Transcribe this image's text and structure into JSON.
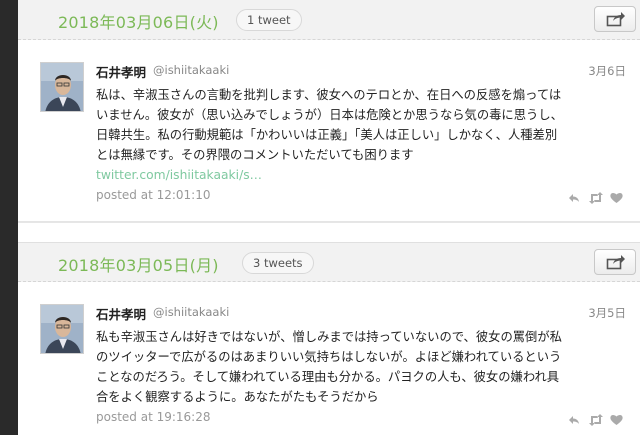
{
  "days": [
    {
      "date": "2018年03月06日(火)",
      "count": "1 tweet",
      "tweets": [
        {
          "name": "石井孝明",
          "handle": "@ishiitakaaki",
          "date": "3月6日",
          "lines": [
            "私は、辛淑玉さんの言動を批判します、彼女へのテロとか、在日への反感を煽っては",
            "いません。彼女が（思い込みでしょうが）日本は危険とか思うなら気の毒に思うし、",
            "日韓共生。私の行動規範は「かわいいは正義」「美人は正しい」しかなく、人種差別",
            "とは無縁です。その界隈のコメントいただいても困ります"
          ],
          "link": "twitter.com/ishiitakaaki/s…",
          "posted": "posted at 12:01:10"
        }
      ]
    },
    {
      "date": "2018年03月05日(月)",
      "count": "3 tweets",
      "tweets": [
        {
          "name": "石井孝明",
          "handle": "@ishiitakaaki",
          "date": "3月5日",
          "lines": [
            "私も辛淑玉さんは好きではないが、憎しみまでは持っていないので、彼女の罵倒が私",
            "のツイッターで広がるのはあまりいい気持ちはしないが。よほど嫌われているという",
            "ことなのだろう。そして嫌われている理由も分かる。パヨクの人も、彼女の嫌われ具",
            "合をよく観察するように。あなたがたもそうだから"
          ],
          "posted": "posted at 19:16:28"
        }
      ]
    }
  ],
  "colors": {
    "date_green": "#7cb957",
    "link_green": "#7fc9a0",
    "header_bg": "#f2f2f2"
  },
  "icons": [
    "share-icon",
    "reply-icon",
    "retweet-icon",
    "like-icon"
  ]
}
